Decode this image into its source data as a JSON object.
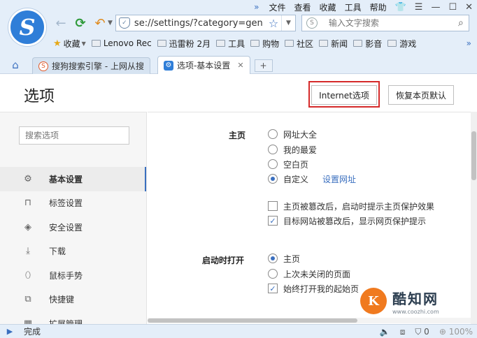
{
  "menubar": {
    "items": [
      "文件",
      "查看",
      "收藏",
      "工具",
      "帮助"
    ]
  },
  "address": {
    "url": "se://settings/?category=gen"
  },
  "search": {
    "placeholder": "输入文字搜索"
  },
  "bookmarks": {
    "favorites_label": "收藏",
    "items": [
      "Lenovo Rec",
      "迅雷粉 2月",
      "工具",
      "购物",
      "社区",
      "新闻",
      "影音",
      "游戏"
    ]
  },
  "tabs": [
    {
      "label": "搜狗搜索引擎 - 上网从搜"
    },
    {
      "label": "选项-基本设置"
    }
  ],
  "page": {
    "title": "选项",
    "internet_button": "Internet选项",
    "restore_button": "恢复本页默认"
  },
  "sidebar": {
    "search_placeholder": "搜索选项",
    "items": [
      {
        "label": "基本设置",
        "icon": "gear-icon"
      },
      {
        "label": "标签设置",
        "icon": "tab-icon"
      },
      {
        "label": "安全设置",
        "icon": "shield-check-icon"
      },
      {
        "label": "下载",
        "icon": "download-icon"
      },
      {
        "label": "鼠标手势",
        "icon": "mouse-icon"
      },
      {
        "label": "快捷键",
        "icon": "shortcut-icon"
      },
      {
        "label": "扩展管理",
        "icon": "extension-icon"
      }
    ]
  },
  "settings": {
    "homepage_label": "主页",
    "homepage_options": [
      "网址大全",
      "我的最爱",
      "空白页",
      "自定义"
    ],
    "homepage_selected": "自定义",
    "set_url_link": "设置网址",
    "protect_checks": [
      {
        "label": "主页被篡改后，启动时提示主页保护效果",
        "checked": false
      },
      {
        "label": "目标网站被篡改后，显示网页保护提示",
        "checked": true
      }
    ],
    "startup_label": "启动时打开",
    "startup_options": [
      "主页",
      "上次未关闭的页面"
    ],
    "startup_selected": "主页",
    "startup_check": {
      "label": "始终打开我的起始页",
      "checked": true
    }
  },
  "watermark": {
    "brand": "酷知网",
    "site": "www.coozhi.com"
  },
  "status": {
    "text": "完成",
    "zoom": "100%"
  },
  "colors": {
    "accent": "#3a6fbf",
    "highlight": "#d52a2a",
    "chrome": "#e4eef9"
  }
}
